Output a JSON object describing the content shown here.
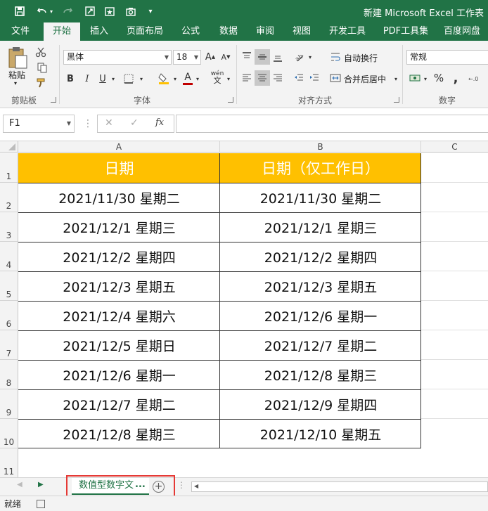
{
  "window": {
    "title": "新建 Microsoft Excel 工作表"
  },
  "quick_access": [
    "save-icon",
    "undo-icon",
    "redo-icon",
    "screenshot-icon",
    "favorite-icon",
    "camera-icon",
    "customize-icon"
  ],
  "ribbon_tabs": [
    {
      "label": "文件",
      "active": false
    },
    {
      "label": "开始",
      "active": true
    },
    {
      "label": "插入",
      "active": false
    },
    {
      "label": "页面布局",
      "active": false
    },
    {
      "label": "公式",
      "active": false
    },
    {
      "label": "数据",
      "active": false
    },
    {
      "label": "审阅",
      "active": false
    },
    {
      "label": "视图",
      "active": false
    },
    {
      "label": "开发工具",
      "active": false
    },
    {
      "label": "PDF工具集",
      "active": false
    },
    {
      "label": "百度网盘",
      "active": false
    }
  ],
  "ribbon": {
    "clipboard": {
      "label": "剪贴板",
      "paste_label": "粘贴"
    },
    "font": {
      "label": "字体",
      "font_name": "黑体",
      "font_size": "18",
      "bold": "B",
      "italic": "I",
      "underline": "U",
      "phonetic": "wén"
    },
    "alignment": {
      "label": "对齐方式",
      "wrap_text": "自动换行",
      "merge_center": "合并后居中"
    },
    "number": {
      "label": "数字",
      "format": "常规",
      "percent": "%"
    }
  },
  "formula_bar": {
    "name_box": "F1",
    "fx": "fx",
    "formula": ""
  },
  "columns": [
    "A",
    "B",
    "C"
  ],
  "rows": [
    "1",
    "2",
    "3",
    "4",
    "5",
    "6",
    "7",
    "8",
    "9",
    "10",
    "11"
  ],
  "table": {
    "headers": [
      "日期",
      "日期（仅工作日）"
    ],
    "rows": [
      [
        "2021/11/30  星期二",
        "2021/11/30  星期二"
      ],
      [
        "2021/12/1  星期三",
        "2021/12/1  星期三"
      ],
      [
        "2021/12/2  星期四",
        "2021/12/2  星期四"
      ],
      [
        "2021/12/3  星期五",
        "2021/12/3  星期五"
      ],
      [
        "2021/12/4  星期六",
        "2021/12/6  星期一"
      ],
      [
        "2021/12/5  星期日",
        "2021/12/7  星期二"
      ],
      [
        "2021/12/6  星期一",
        "2021/12/8  星期三"
      ],
      [
        "2021/12/7  星期二",
        "2021/12/9  星期四"
      ],
      [
        "2021/12/8  星期三",
        "2021/12/10  星期五"
      ]
    ]
  },
  "colors": {
    "excel_green": "#217346",
    "header_fill": "#ffc000",
    "highlight": "#e53935"
  },
  "sheets": {
    "active_tab": "数值型数字文",
    "ellipsis": "...",
    "add_icon": "add-sheet-icon"
  },
  "status": {
    "ready": "就绪"
  }
}
